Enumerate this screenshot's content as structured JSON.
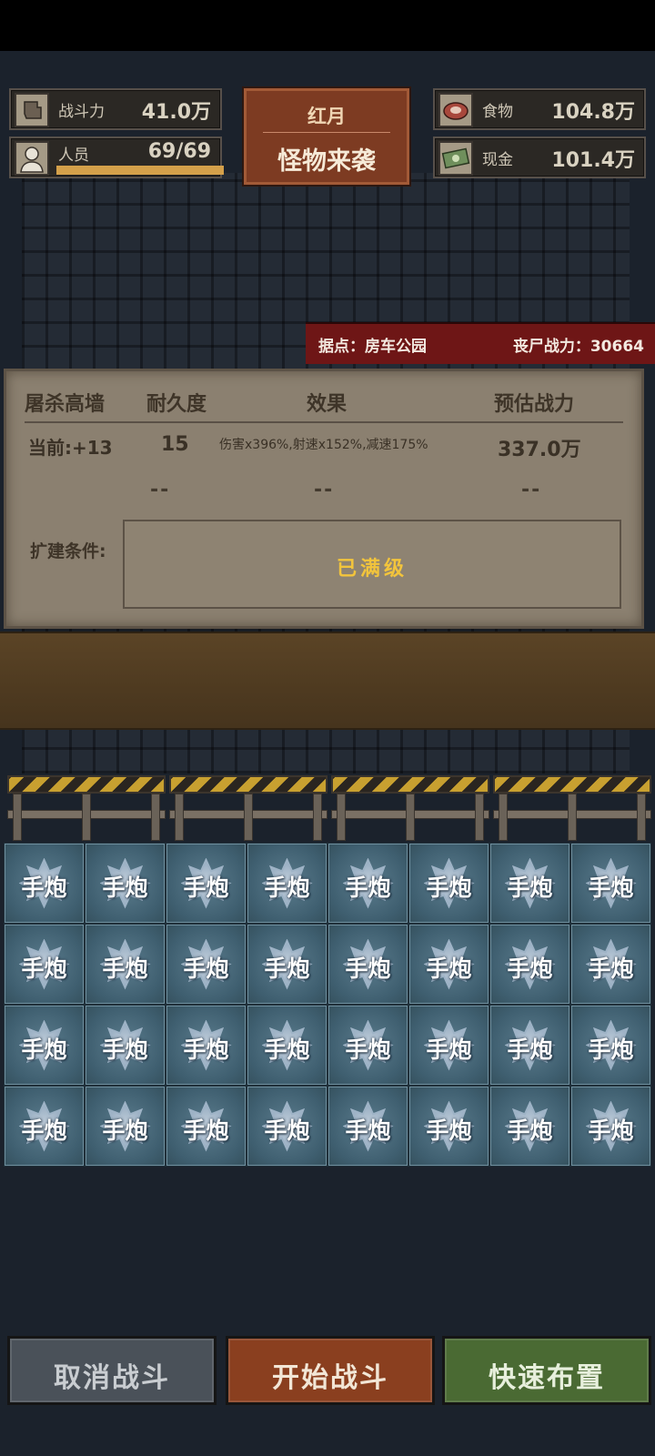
{
  "stats": {
    "combat": {
      "label": "战斗力",
      "value": "41.0万"
    },
    "staff": {
      "label": "人员",
      "value": "69/69",
      "fill_fraction": 1.0
    },
    "food": {
      "label": "食物",
      "value": "104.8万"
    },
    "cash": {
      "label": "现金",
      "value": "101.4万"
    }
  },
  "event": {
    "tag": "红月",
    "title": "怪物来袭"
  },
  "location": {
    "base": "据点：房车公园",
    "zombie_power": "丧尸战力：30664"
  },
  "info": {
    "headers": [
      "屠杀高墙",
      "耐久度",
      "效果",
      "预估战力"
    ],
    "current": {
      "level": "当前:+13",
      "durability": "15",
      "effect": "伤害x396%,射速x152%,减速175%",
      "power": "337.0万"
    },
    "next": {
      "durability": "--",
      "effect": "--",
      "power": "--"
    },
    "expand_label": "扩建条件:",
    "expand_value": "已满级"
  },
  "slot_label": "手炮",
  "slot_count": 32,
  "buttons": {
    "cancel": "取消战斗",
    "start": "开始战斗",
    "quick": "快速布置"
  },
  "colors": {
    "event_red": "#7d3b22",
    "location_red": "#6e1616",
    "maxed_yellow": "#f2c43c",
    "staff_bar": "#d4a04a"
  },
  "icons": {
    "combat": "fist-icon",
    "staff": "person-icon",
    "food": "meat-icon",
    "cash": "cash-icon",
    "slot": "star-badge-icon"
  }
}
